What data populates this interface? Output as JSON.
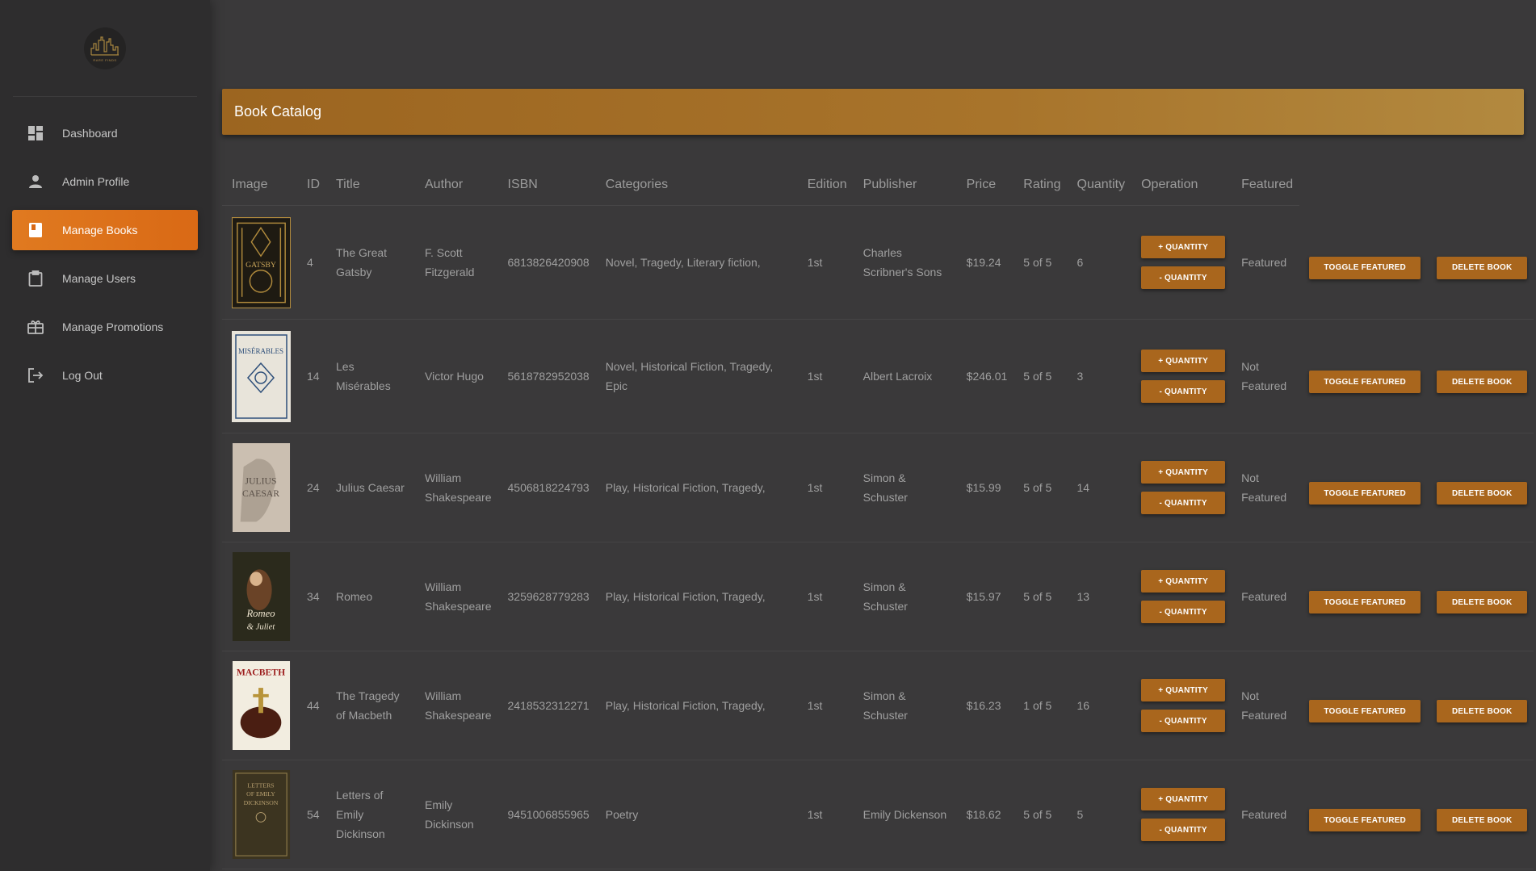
{
  "sidebar": {
    "logo_text": "RARE FINDS",
    "items": [
      {
        "label": "Dashboard",
        "icon": "dashboard-icon"
      },
      {
        "label": "Admin Profile",
        "icon": "person-icon"
      },
      {
        "label": "Manage Books",
        "icon": "book-icon",
        "active": true
      },
      {
        "label": "Manage Users",
        "icon": "clipboard-icon"
      },
      {
        "label": "Manage Promotions",
        "icon": "gift-icon"
      },
      {
        "label": "Log Out",
        "icon": "logout-icon"
      }
    ]
  },
  "header": {
    "title": "Book Catalog"
  },
  "table": {
    "columns": [
      "Image",
      "ID",
      "Title",
      "Author",
      "ISBN",
      "Categories",
      "Edition",
      "Publisher",
      "Price",
      "Rating",
      "Quantity",
      "Operation",
      "Featured"
    ],
    "buttons": {
      "plus_quantity": "+ QUANTITY",
      "minus_quantity": "- QUANTITY",
      "toggle_featured": "TOGGLE FEATURED",
      "delete_book": "DELETE BOOK"
    },
    "rows": [
      {
        "cover": "The Great Gatsby cover",
        "cover_colors": [
          "#1e1a12",
          "#b08a3c"
        ],
        "id": "4",
        "title": "The Great Gatsby",
        "author": "F. Scott Fitzgerald",
        "isbn": "6813826420908",
        "categories": "Novel, Tragedy, Literary fiction,",
        "edition": "1st",
        "publisher": "Charles Scribner's Sons",
        "price": "$19.24",
        "rating": "5 of 5",
        "quantity": "6",
        "featured": "Featured"
      },
      {
        "cover": "Les Misérables cover",
        "cover_colors": [
          "#e8e4da",
          "#2e4f7a"
        ],
        "id": "14",
        "title": "Les Misérables",
        "author": "Victor Hugo",
        "isbn": "5618782952038",
        "categories": "Novel, Historical Fiction, Tragedy, Epic",
        "edition": "1st",
        "publisher": "Albert Lacroix",
        "price": "$246.01",
        "rating": "5 of 5",
        "quantity": "3",
        "featured": "Not Featured"
      },
      {
        "cover": "Julius Caesar cover",
        "cover_colors": [
          "#cbbfb1",
          "#8a7c6e"
        ],
        "id": "24",
        "title": "Julius Caesar",
        "author": "William Shakespeare",
        "isbn": "4506818224793",
        "categories": "Play, Historical Fiction, Tragedy,",
        "edition": "1st",
        "publisher": "Simon & Schuster",
        "price": "$15.99",
        "rating": "5 of 5",
        "quantity": "14",
        "featured": "Not Featured"
      },
      {
        "cover": "Romeo & Juliet cover",
        "cover_colors": [
          "#2b2a1c",
          "#7a4a2a"
        ],
        "id": "34",
        "title": "Romeo",
        "author": "William Shakespeare",
        "isbn": "3259628779283",
        "categories": "Play, Historical Fiction, Tragedy,",
        "edition": "1st",
        "publisher": "Simon & Schuster",
        "price": "$15.97",
        "rating": "5 of 5",
        "quantity": "13",
        "featured": "Featured"
      },
      {
        "cover": "Macbeth cover",
        "cover_colors": [
          "#f2ede0",
          "#4a1e12"
        ],
        "id": "44",
        "title": "The Tragedy of Macbeth",
        "author": "William Shakespeare",
        "isbn": "2418532312271",
        "categories": "Play, Historical Fiction, Tragedy,",
        "edition": "1st",
        "publisher": "Simon & Schuster",
        "price": "$16.23",
        "rating": "1 of 5",
        "quantity": "16",
        "featured": "Not Featured"
      },
      {
        "cover": "Letters of Emily Dickinson cover",
        "cover_colors": [
          "#3c3420",
          "#8c7a4a"
        ],
        "id": "54",
        "title": "Letters of Emily Dickinson",
        "author": "Emily Dickinson",
        "isbn": "9451006855965",
        "categories": "Poetry",
        "edition": "1st",
        "publisher": "Emily Dickenson",
        "price": "$18.62",
        "rating": "5 of 5",
        "quantity": "5",
        "featured": "Featured"
      }
    ]
  },
  "colors": {
    "accent": "#d96915",
    "button": "#a9661d",
    "header": "#a8742b",
    "background": "#3a393a",
    "sidebar": "#2e2d2e"
  }
}
